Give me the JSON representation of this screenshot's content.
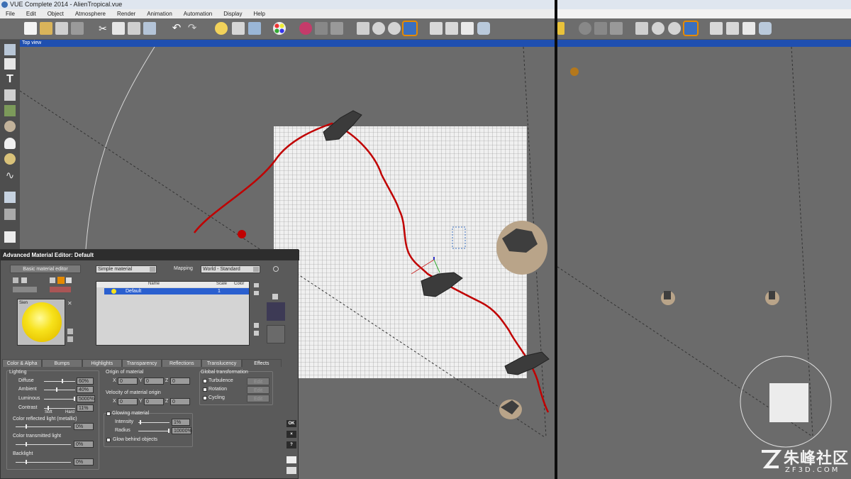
{
  "window": {
    "title": "VUE Complete 2014 - AlienTropical.vue"
  },
  "menu": [
    "File",
    "Edit",
    "Object",
    "Atmosphere",
    "Render",
    "Animation",
    "Automation",
    "Display",
    "Help"
  ],
  "viewport": {
    "label": "Top view"
  },
  "editor": {
    "title": "Advanced Material Editor: Default",
    "basic_button": "Basic material editor",
    "material_type": "Simple material",
    "mapping_label": "Mapping",
    "mapping_value": "World - Standard",
    "preview_label": "Sien",
    "list_headers": {
      "name": "Name",
      "scale": "Scale",
      "color": "Color"
    },
    "list_row": {
      "name": "Default",
      "scale": "1"
    },
    "tabs": [
      "Color & Alpha",
      "Bumps",
      "Highlights",
      "Transparency",
      "Reflections",
      "Translucency",
      "Effects"
    ],
    "active_tab": "Effects",
    "lighting": {
      "title": "Lighting",
      "rows": [
        {
          "label": "Diffuse",
          "value": "60%",
          "level": 0.6
        },
        {
          "label": "Ambient",
          "value": "40%",
          "level": 0.4
        },
        {
          "label": "Luminous",
          "value": "5000%",
          "level": 1.0
        },
        {
          "label": "Contrast",
          "value": "11%",
          "level": 0.11
        }
      ],
      "soft": "Soft",
      "hard": "Hard"
    },
    "reflected": {
      "title": "Color reflected light (metallic)",
      "value": "0%"
    },
    "transmitted": {
      "title": "Color transmitted light",
      "value": "0%"
    },
    "backlight": {
      "title": "Backlight",
      "value": "0%"
    },
    "origin": {
      "title": "Origin of material",
      "x": "0",
      "y": "0",
      "z": "0"
    },
    "velocity": {
      "title": "Velocity of material origin",
      "x": "0",
      "y": "0",
      "z": "0"
    },
    "glowing": {
      "title": "Glowing material",
      "intensity_label": "Intensity",
      "intensity_value": "1%",
      "radius_label": "Radius",
      "radius_value": "10000%",
      "glow_behind": "Glow behind objects"
    },
    "global": {
      "title": "Global transformation",
      "items": [
        {
          "label": "Turbulence",
          "edit": "Edit"
        },
        {
          "label": "Rotation",
          "edit": "Edit"
        },
        {
          "label": "Cycling",
          "edit": "Edit"
        }
      ]
    },
    "ok": "OK",
    "close": "×",
    "help": "?"
  },
  "axis_letters": {
    "x": "X",
    "y": "Y",
    "z": "Z"
  },
  "watermark": {
    "main": "朱峰社区",
    "sub": "ZF3D.COM"
  },
  "colors": {
    "accent": "#1f4fb0",
    "selected_row": "#2a5fcf",
    "red_path": "#c00000",
    "viewport_bg": "#6b6b6b"
  }
}
